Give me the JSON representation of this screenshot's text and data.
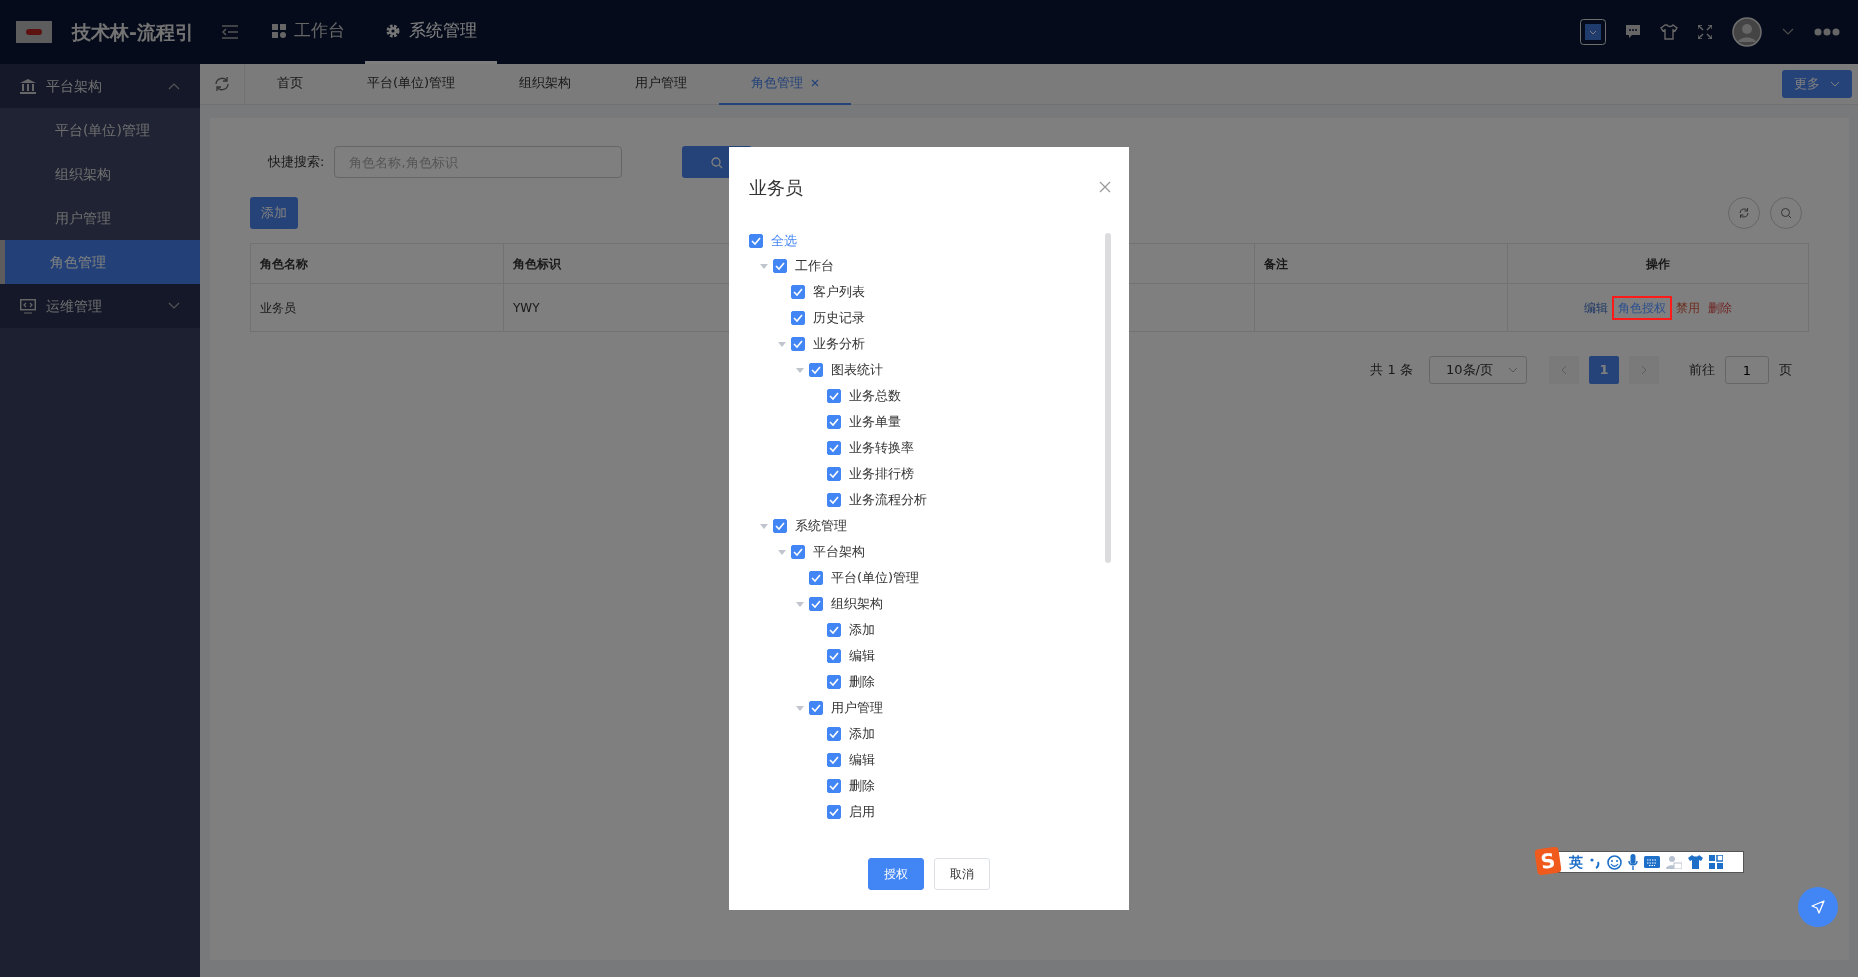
{
  "app": {
    "title": "技术林-流程引"
  },
  "top_nav": [
    {
      "label": "工作台",
      "selected": false
    },
    {
      "label": "系统管理",
      "selected": true
    }
  ],
  "sidebar": [
    {
      "label": "平台架构",
      "expanded": true,
      "children": [
        {
          "label": "平台(单位)管理",
          "selected": false
        },
        {
          "label": "组织架构",
          "selected": false
        },
        {
          "label": "用户管理",
          "selected": false
        },
        {
          "label": "角色管理",
          "selected": true
        }
      ]
    },
    {
      "label": "运维管理",
      "expanded": false
    }
  ],
  "tabs": [
    {
      "label": "首页",
      "selected": false,
      "closable": false
    },
    {
      "label": "平台(单位)管理",
      "selected": false,
      "closable": false
    },
    {
      "label": "组织架构",
      "selected": false,
      "closable": false
    },
    {
      "label": "用户管理",
      "selected": false,
      "closable": false
    },
    {
      "label": "角色管理",
      "selected": true,
      "closable": true
    }
  ],
  "more_button": "更多",
  "search": {
    "label": "快捷搜索:",
    "placeholder": "角色名称,角色标识"
  },
  "add_button": "添加",
  "table": {
    "columns": [
      "角色名称",
      "角色标识",
      "备注",
      "操作"
    ],
    "rows": [
      {
        "name": "业务员",
        "code": "YWY",
        "actions": [
          {
            "label": "编辑",
            "kind": "primary",
            "highlighted": false
          },
          {
            "label": "角色授权",
            "kind": "primary",
            "highlighted": true
          },
          {
            "label": "禁用",
            "kind": "warning",
            "highlighted": false
          },
          {
            "label": "删除",
            "kind": "danger",
            "highlighted": false
          }
        ]
      }
    ]
  },
  "pagination": {
    "total": "共 1 条",
    "page_size": "10条/页",
    "pages": [
      {
        "label": "1",
        "selected": true
      }
    ],
    "goto_label": "前往",
    "goto_value": "1",
    "goto_suffix": "页"
  },
  "dialog": {
    "title": "业务员",
    "select_all": {
      "label": "全选",
      "checked": true
    },
    "tree": [
      {
        "label": "工作台",
        "checked": true,
        "expanded": true,
        "children": [
          {
            "label": "客户列表",
            "checked": true
          },
          {
            "label": "历史记录",
            "checked": true
          },
          {
            "label": "业务分析",
            "checked": true,
            "expanded": true,
            "children": [
              {
                "label": "图表统计",
                "checked": true,
                "expanded": true,
                "children": [
                  {
                    "label": "业务总数",
                    "checked": true
                  },
                  {
                    "label": "业务单量",
                    "checked": true
                  },
                  {
                    "label": "业务转换率",
                    "checked": true
                  },
                  {
                    "label": "业务排行榜",
                    "checked": true
                  },
                  {
                    "label": "业务流程分析",
                    "checked": true
                  }
                ]
              }
            ]
          }
        ]
      },
      {
        "label": "系统管理",
        "checked": true,
        "expanded": true,
        "children": [
          {
            "label": "平台架构",
            "checked": true,
            "expanded": true,
            "children": [
              {
                "label": "平台(单位)管理",
                "checked": true
              },
              {
                "label": "组织架构",
                "checked": true,
                "expanded": true,
                "children": [
                  {
                    "label": "添加",
                    "checked": true
                  },
                  {
                    "label": "编辑",
                    "checked": true
                  },
                  {
                    "label": "删除",
                    "checked": true
                  }
                ]
              },
              {
                "label": "用户管理",
                "checked": true,
                "expanded": true,
                "children": [
                  {
                    "label": "添加",
                    "checked": true
                  },
                  {
                    "label": "编辑",
                    "checked": true
                  },
                  {
                    "label": "删除",
                    "checked": true
                  },
                  {
                    "label": "启用",
                    "checked": true
                  }
                ]
              }
            ]
          }
        ]
      }
    ],
    "buttons": [
      {
        "label": "授权",
        "kind": "primary"
      },
      {
        "label": "取消",
        "kind": "default"
      }
    ]
  },
  "ime": {
    "logo": "S",
    "mode": "英"
  }
}
